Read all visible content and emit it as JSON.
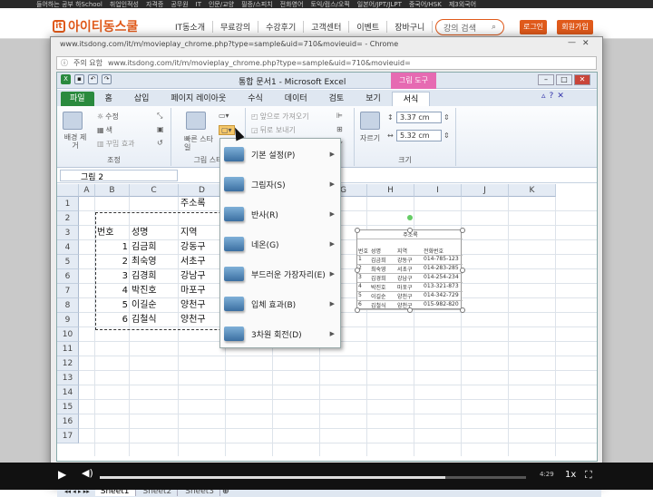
{
  "site": {
    "top_links": [
      "들어하는 공부 하School",
      "취업인적성",
      "자격증",
      "공무원",
      "IT",
      "인문/교양",
      "필증/스피치",
      "전화영어",
      "토익/컴스/오픽",
      "일본어/JPT/JLPT",
      "중국어/HSK",
      "제3외국어"
    ],
    "logo": "아이티동스쿨",
    "nav": [
      "IT동소개",
      "무료강의",
      "수강후기",
      "고객센터",
      "이벤트",
      "장바구니"
    ],
    "search_placeholder": "강의 검색",
    "login": "로그인",
    "join": "회원가입"
  },
  "chrome": {
    "title": "www.itsdong.com/it/m/movieplay_chrome.php?type=sample&uid=710&movieuid= - Chrome",
    "secure_label": "주의 요함",
    "url": "www.itsdong.com/it/m/movieplay_chrome.php?type=sample&uid=710&movieuid="
  },
  "excel": {
    "title": "통합 문서1 - Microsoft Excel",
    "context_tab": "그림 도구",
    "tabs": [
      "파일",
      "홈",
      "삽입",
      "페이지 레이아웃",
      "수식",
      "데이터",
      "검토",
      "보기",
      "서식"
    ],
    "ribbon": {
      "bg_remove": "배경 제거",
      "correct": "수정",
      "color": "색",
      "artistic": "꾸밈 효과",
      "adjust_group": "조정",
      "pic_style": "빠른 스타일",
      "pic_style_group": "그림 스타",
      "bring_forward": "앞으로 가져오기",
      "send_back": "뒤로 보내기",
      "crop": "자르기",
      "height": "3.37 cm",
      "width": "5.32 cm",
      "size_group": "크기"
    },
    "namebox": "그림 2",
    "columns": [
      "A",
      "B",
      "C",
      "D",
      "E",
      "F",
      "G",
      "H",
      "I",
      "J",
      "K"
    ],
    "rows": [
      "1",
      "2",
      "3",
      "4",
      "5",
      "6",
      "7",
      "8",
      "9",
      "10",
      "11",
      "12",
      "13",
      "14",
      "15",
      "16",
      "17"
    ],
    "cells": {
      "title": "주소록",
      "headers": [
        "번호",
        "성명",
        "지역"
      ],
      "data": [
        [
          "1",
          "김금희",
          "강동구"
        ],
        [
          "2",
          "최숙영",
          "서초구"
        ],
        [
          "3",
          "김경희",
          "강남구"
        ],
        [
          "4",
          "박진호",
          "마포구"
        ],
        [
          "5",
          "이길순",
          "양천구"
        ],
        [
          "6",
          "김철식",
          "양천구"
        ]
      ]
    },
    "picture": {
      "title": "주소록",
      "rows": [
        [
          "번호",
          "성명",
          "지역",
          "전화번호"
        ],
        [
          "1",
          "김금희",
          "강동구",
          "014-785-1234"
        ],
        [
          "2",
          "최숙영",
          "서초구",
          "014-283-2850"
        ],
        [
          "3",
          "김경희",
          "강남구",
          "014-254-2345"
        ],
        [
          "4",
          "박진호",
          "마포구",
          "013-321-8732"
        ],
        [
          "5",
          "이길순",
          "양천구",
          "014-342-7294"
        ],
        [
          "6",
          "김철식",
          "양천구",
          "015-982-8201"
        ]
      ]
    },
    "menu": [
      "기본 설정(P)",
      "그림자(S)",
      "반사(R)",
      "네온(G)",
      "부드러운 가장자리(E)",
      "입체 효과(B)",
      "3차원 회전(D)"
    ],
    "sheets": [
      "Sheet1",
      "Sheet2",
      "Sheet3"
    ]
  },
  "player": {
    "time": "4:29",
    "speed": "1x",
    "progress": 0.81
  }
}
